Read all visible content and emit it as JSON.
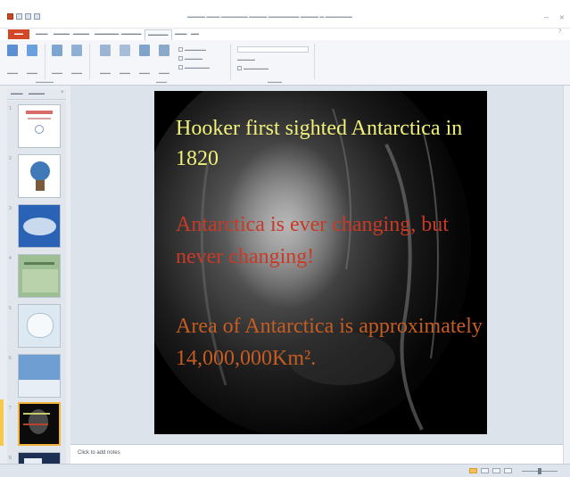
{
  "slide": {
    "line1": "Hooker first sighted Antarctica in",
    "line2": "1820",
    "line3": "Antarctica is ever changing, but",
    "line4": "never changing!",
    "line5": "Area of Antarctica is approximately",
    "line6": "14,000,000Km²."
  },
  "notes": {
    "placeholder": "Click to add notes"
  },
  "thumbnails": {
    "count": 8,
    "selected_index": 7
  },
  "colors": {
    "file_tab": "#d24726",
    "line1_color": "#f0f07a",
    "line2_color": "#c93a26",
    "line3_color": "#c55c21",
    "selection_border": "#f2b33d"
  },
  "icons": [
    "save-icon",
    "undo-icon",
    "redo-icon",
    "minimize-icon",
    "close-icon",
    "help-icon",
    "normal-view-icon",
    "slide-sorter-icon",
    "reading-view-icon",
    "slideshow-icon"
  ]
}
